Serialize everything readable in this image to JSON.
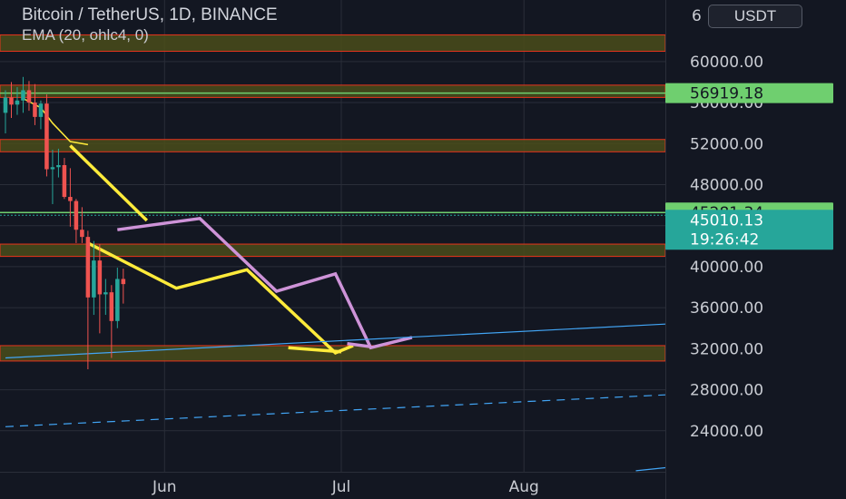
{
  "header": {
    "title": "Bitcoin / TetherUS, 1D, BINANCE",
    "indicator": "EMA (20, ohlc4, 0)",
    "currency": "USDT",
    "clipped_top_label": "6"
  },
  "colors": {
    "background": "#131722",
    "zone_fill": "#4a4c1a",
    "zone_border": "#e8341c",
    "green_level": "#6fcf6f",
    "candle_up": "#26a69a",
    "candle_down": "#ef5350",
    "yellow_path": "#ffeb3b",
    "pink_path": "#ce93d8",
    "blue_trend": "#42a5f5",
    "price_tag": "#26a69a"
  },
  "chart_data": {
    "type": "line",
    "title": "Bitcoin / TetherUS, 1D, BINANCE",
    "ylim": [
      20000,
      66000
    ],
    "yticks": [
      24000,
      28000,
      32000,
      36000,
      40000,
      44000,
      48000,
      52000,
      56000,
      60000
    ],
    "ytick_labels": [
      "24000.00",
      "28000.00",
      "32000.00",
      "36000.00",
      "40000.00",
      "",
      "48000.00",
      "52000.00",
      "56000.00",
      "60000.00"
    ],
    "xticks": [
      "Jun",
      "Jul",
      "Aug"
    ],
    "xtick_dates": [
      "2021-06-01",
      "2021-07-01",
      "2021-08-01"
    ],
    "xlim": [
      "2021-05-05",
      "2021-08-25"
    ],
    "grid": true,
    "price_labels": [
      {
        "name": "level",
        "value": 56919.18,
        "label": "56919.18",
        "style": "green"
      },
      {
        "name": "level",
        "value": 45281.34,
        "label": "45281.34",
        "style": "green"
      },
      {
        "name": "last-price",
        "value": 45010.13,
        "label": "45010.13",
        "countdown": "19:26:42",
        "style": "teal"
      }
    ],
    "zones": [
      {
        "low": 61000,
        "high": 62600
      },
      {
        "low": 56500,
        "high": 57700
      },
      {
        "low": 51200,
        "high": 52400
      },
      {
        "low": 41000,
        "high": 42200
      },
      {
        "low": 30800,
        "high": 32300
      }
    ],
    "candles": [
      {
        "date": "2021-05-05",
        "open": 55000,
        "high": 57200,
        "low": 53000,
        "close": 56500
      },
      {
        "date": "2021-05-06",
        "open": 56500,
        "high": 58000,
        "low": 54500,
        "close": 55800
      },
      {
        "date": "2021-05-07",
        "open": 55800,
        "high": 57500,
        "low": 54800,
        "close": 56200
      },
      {
        "date": "2021-05-08",
        "open": 56200,
        "high": 58500,
        "low": 55000,
        "close": 57200
      },
      {
        "date": "2021-05-09",
        "open": 57200,
        "high": 58100,
        "low": 55200,
        "close": 56000
      },
      {
        "date": "2021-05-10",
        "open": 56000,
        "high": 57800,
        "low": 53800,
        "close": 54600
      },
      {
        "date": "2021-05-11",
        "open": 54600,
        "high": 56200,
        "low": 53400,
        "close": 55900
      },
      {
        "date": "2021-05-12",
        "open": 55900,
        "high": 56800,
        "low": 48800,
        "close": 49500
      },
      {
        "date": "2021-05-13",
        "open": 49500,
        "high": 51400,
        "low": 46100,
        "close": 49700
      },
      {
        "date": "2021-05-14",
        "open": 49700,
        "high": 51500,
        "low": 48700,
        "close": 49900
      },
      {
        "date": "2021-05-15",
        "open": 49900,
        "high": 50600,
        "low": 46600,
        "close": 46800
      },
      {
        "date": "2021-05-16",
        "open": 46800,
        "high": 49600,
        "low": 43900,
        "close": 46400
      },
      {
        "date": "2021-05-17",
        "open": 46400,
        "high": 46600,
        "low": 42300,
        "close": 43600
      },
      {
        "date": "2021-05-18",
        "open": 43600,
        "high": 45800,
        "low": 42300,
        "close": 42900
      },
      {
        "date": "2021-05-19",
        "open": 42900,
        "high": 43500,
        "low": 30000,
        "close": 37000
      },
      {
        "date": "2021-05-20",
        "open": 37000,
        "high": 42500,
        "low": 35300,
        "close": 40600
      },
      {
        "date": "2021-05-21",
        "open": 40600,
        "high": 42200,
        "low": 33500,
        "close": 37300
      },
      {
        "date": "2021-05-22",
        "open": 37300,
        "high": 38800,
        "low": 35300,
        "close": 37500
      },
      {
        "date": "2021-05-23",
        "open": 37500,
        "high": 38200,
        "low": 31100,
        "close": 34700
      },
      {
        "date": "2021-05-24",
        "open": 34700,
        "high": 39900,
        "low": 34000,
        "close": 38800
      },
      {
        "date": "2021-05-25",
        "open": 38800,
        "high": 39800,
        "low": 36400,
        "close": 38300
      }
    ],
    "series": [
      {
        "kind": "ema",
        "points": [
          [
            "2021-05-08",
            56400
          ],
          [
            "2021-05-11",
            55500
          ],
          [
            "2021-05-13",
            54000
          ],
          [
            "2021-05-16",
            52200
          ],
          [
            "2021-05-19",
            51900
          ]
        ]
      },
      {
        "kind": "yellow",
        "points": [
          [
            "2021-05-16",
            51800
          ],
          [
            "2021-05-29",
            44500
          ]
        ]
      },
      {
        "kind": "yellow",
        "points": [
          [
            "2021-05-19",
            42300
          ],
          [
            "2021-06-03",
            37900
          ],
          [
            "2021-06-15",
            39700
          ],
          [
            "2021-06-30",
            31600
          ],
          [
            "2021-07-03",
            32300
          ]
        ]
      },
      {
        "kind": "yellow",
        "points": [
          [
            "2021-06-22",
            32100
          ],
          [
            "2021-06-31",
            31700
          ]
        ]
      },
      {
        "kind": "pink",
        "points": [
          [
            "2021-05-24",
            43600
          ],
          [
            "2021-06-07",
            44700
          ],
          [
            "2021-06-20",
            37600
          ],
          [
            "2021-06-30",
            39300
          ],
          [
            "2021-07-06",
            32100
          ],
          [
            "2021-07-13",
            33100
          ]
        ]
      },
      {
        "kind": "pink",
        "points": [
          [
            "2021-07-02",
            32500
          ],
          [
            "2021-07-06",
            32200
          ]
        ]
      },
      {
        "kind": "blue-solid",
        "points": [
          [
            "2021-05-05",
            31100
          ],
          [
            "2021-08-25",
            34400
          ]
        ]
      },
      {
        "kind": "blue-dashed",
        "points": [
          [
            "2021-05-05",
            24400
          ],
          [
            "2021-08-25",
            27500
          ]
        ]
      },
      {
        "kind": "blue-solid",
        "points": [
          [
            "2021-08-20",
            20100
          ],
          [
            "2021-08-25",
            20400
          ]
        ]
      }
    ]
  }
}
